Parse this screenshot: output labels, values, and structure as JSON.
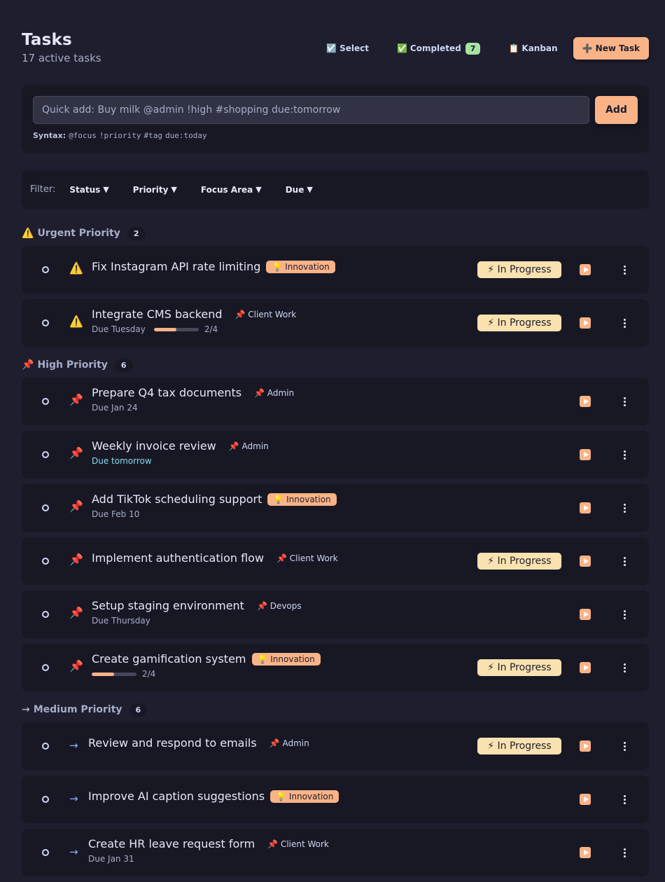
{
  "header": {
    "title": "Tasks",
    "subtitle": "17 active tasks",
    "select_label": "Select",
    "select_icon": "☑️",
    "completed_label": "Completed",
    "completed_icon": "✅",
    "completed_count": "7",
    "kanban_label": "Kanban",
    "kanban_icon": "📋",
    "new_task_label": "➕ New Task"
  },
  "quick_add": {
    "placeholder": "Quick add: Buy milk @admin !high #shopping due:tomorrow",
    "add_label": "Add",
    "syntax_label": "Syntax:",
    "syntax_tokens": [
      "@focus",
      "!priority",
      "#tag",
      "due:today"
    ]
  },
  "filters": {
    "label": "Filter:",
    "status": "Status",
    "priority": "Priority",
    "focus_area": "Focus Area",
    "due": "Due",
    "caret": "▼"
  },
  "groups": [
    {
      "icon": "⚠️",
      "label": "Urgent Priority",
      "count": "2",
      "tasks": [
        {
          "title": "Fix Instagram API rate limiting",
          "tag": "💡 Innovation",
          "status": "⚡ In Progress"
        },
        {
          "title": "Integrate CMS backend",
          "tag": "📌 Client Work",
          "due": "Due Tuesday",
          "progress": 0.5,
          "progress_text": "2/4",
          "status": "⚡ In Progress"
        }
      ]
    },
    {
      "icon": "📌",
      "label": "High Priority",
      "count": "6",
      "tasks": [
        {
          "title": "Prepare Q4 tax documents",
          "tag": "📌 Admin",
          "due": "Due Jan 24"
        },
        {
          "title": "Weekly invoice review",
          "tag": "📌 Admin",
          "due": "Due tomorrow"
        },
        {
          "title": "Add TikTok scheduling support",
          "tag": "💡 Innovation",
          "due": "Due Feb 10"
        },
        {
          "title": "Implement authentication flow",
          "tag": "📌 Client Work",
          "status": "⚡ In Progress"
        },
        {
          "title": "Setup staging environment",
          "tag": "📌 Devops",
          "due": "Due Thursday"
        },
        {
          "title": "Create gamification system",
          "tag": "💡 Innovation",
          "progress": 0.5,
          "progress_text": "2/4",
          "status": "⚡ In Progress"
        }
      ]
    },
    {
      "icon": "→",
      "label": "Medium Priority",
      "count": "6",
      "tasks": [
        {
          "title": "Review and respond to emails",
          "tag": "📌 Admin",
          "status": "⚡ In Progress"
        },
        {
          "title": "Improve AI caption suggestions",
          "tag": "💡 Innovation"
        },
        {
          "title": "Create HR leave request form",
          "tag": "📌 Client Work",
          "due": "Due Jan 31"
        }
      ]
    }
  ],
  "colors": {
    "background": "#1e1e2e",
    "card": "#181825",
    "accent": "#fab387",
    "status_in_progress": "#f9e2af",
    "completed_badge": "#a6e3a1",
    "due_tomorrow": "#89dceb",
    "medium_arrow": "#89b4fa"
  }
}
